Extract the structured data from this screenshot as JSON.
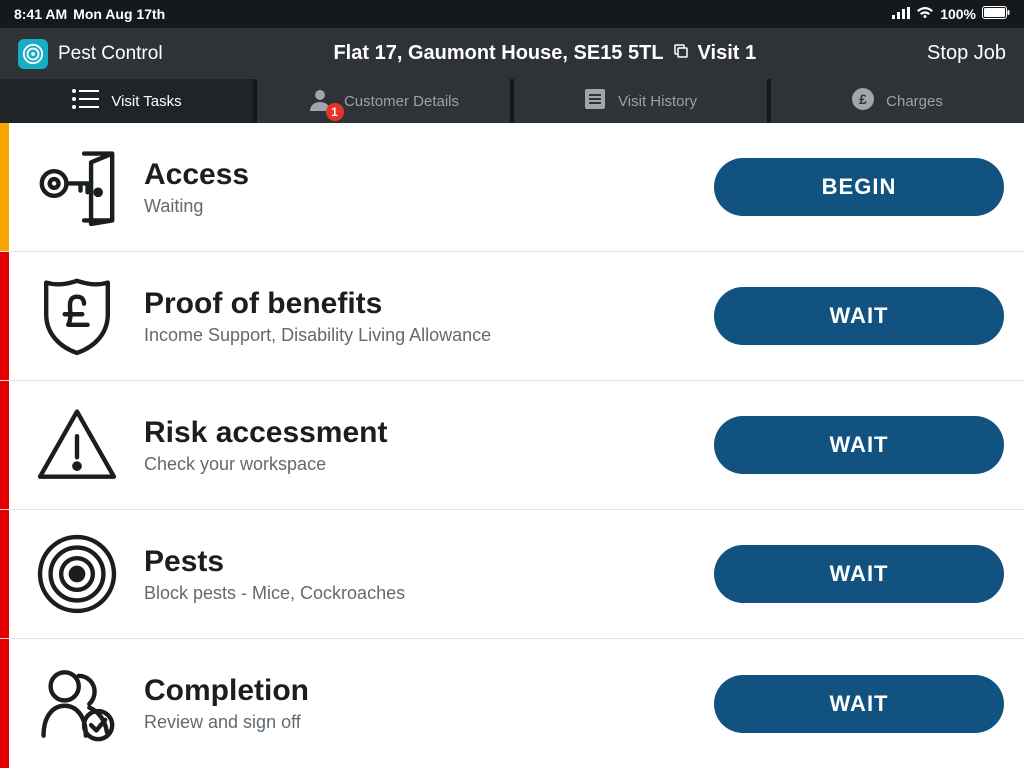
{
  "statusbar": {
    "time": "8:41 AM",
    "date": "Mon Aug 17th",
    "battery": "100%"
  },
  "header": {
    "appname": "Pest Control",
    "address": "Flat 17, Gaumont House, SE15 5TL",
    "visit": "Visit 1",
    "stopjob": "Stop Job"
  },
  "tabs": [
    {
      "label": "Visit Tasks",
      "active": true
    },
    {
      "label": "Customer Details",
      "badge": "1"
    },
    {
      "label": "Visit History"
    },
    {
      "label": "Charges"
    }
  ],
  "tasks": [
    {
      "title": "Access",
      "subtitle": "Waiting",
      "button": "BEGIN",
      "stripe": "orange",
      "icon": "key-door"
    },
    {
      "title": "Proof of benefits",
      "subtitle": "Income Support, Disability Living Allowance",
      "button": "WAIT",
      "stripe": "red",
      "icon": "pound-shield"
    },
    {
      "title": "Risk accessment",
      "subtitle": "Check your workspace",
      "button": "WAIT",
      "stripe": "red",
      "icon": "warning"
    },
    {
      "title": "Pests",
      "subtitle": "Block pests - Mice, Cockroaches",
      "button": "WAIT",
      "stripe": "red",
      "icon": "target"
    },
    {
      "title": "Completion",
      "subtitle": "Review and sign off",
      "button": "WAIT",
      "stripe": "red",
      "icon": "people-check"
    }
  ]
}
